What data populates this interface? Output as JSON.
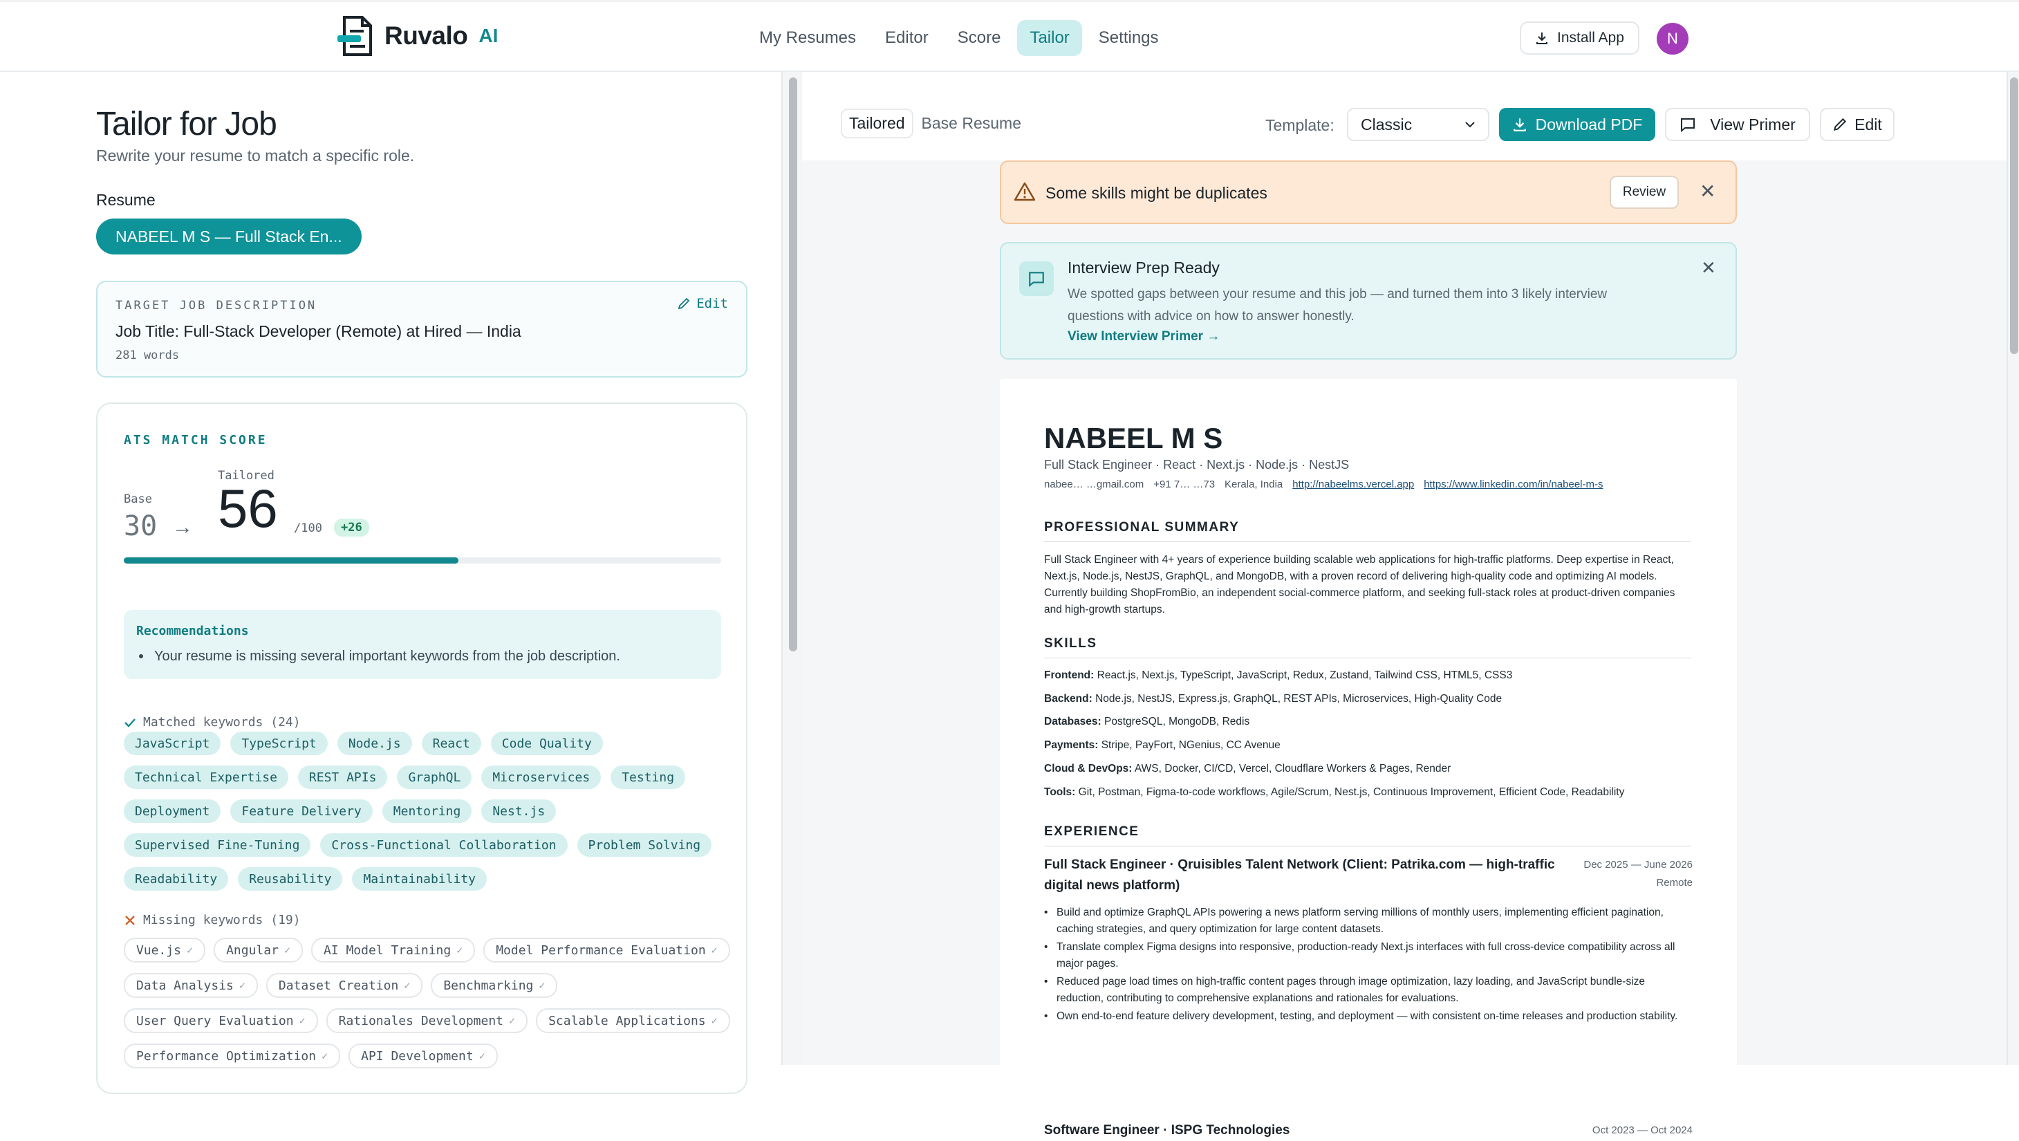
{
  "app": {
    "name": "Ruvalo",
    "suffix": "AI"
  },
  "nav": {
    "items": [
      {
        "label": "My Resumes",
        "active": false
      },
      {
        "label": "Editor",
        "active": false
      },
      {
        "label": "Score",
        "active": false
      },
      {
        "label": "Tailor",
        "active": true
      },
      {
        "label": "Settings",
        "active": false
      }
    ],
    "install_label": "Install App",
    "avatar_initial": "N"
  },
  "left": {
    "title": "Tailor for Job",
    "subtitle": "Rewrite your resume to match a specific role.",
    "resume_label": "Resume",
    "resume_selected": "NABEEL M S — Full Stack En...",
    "jd": {
      "label": "TARGET JOB DESCRIPTION",
      "edit_label": "Edit",
      "title": "Job Title: Full-Stack Developer (Remote) at Hired — India",
      "words": "281 words"
    },
    "ats": {
      "label": "ATS MATCH SCORE",
      "base_label": "Base",
      "base_value": "30",
      "arrow": "→",
      "tailored_label": "Tailored",
      "tailored_value": "56",
      "out_of": "/100",
      "delta": "+26",
      "progress": 0.56,
      "rec_title": "Recommendations",
      "rec_item": "Your resume is missing several important keywords from the job description.",
      "matched_header": "Matched keywords (24)",
      "matched": [
        "JavaScript",
        "TypeScript",
        "Node.js",
        "React",
        "Code Quality",
        "Technical Expertise",
        "REST APIs",
        "GraphQL",
        "Microservices",
        "Testing",
        "Deployment",
        "Feature Delivery",
        "Mentoring",
        "Nest.js",
        "Supervised Fine-Tuning",
        "Cross-Functional Collaboration",
        "Problem Solving",
        "Readability",
        "Reusability",
        "Maintainability"
      ],
      "missing_header": "Missing keywords (19)",
      "missing": [
        "Vue.js",
        "Angular",
        "AI Model Training",
        "Model Performance Evaluation",
        "Data Analysis",
        "Dataset Creation",
        "Benchmarking",
        "User Query Evaluation",
        "Rationales Development",
        "Scalable Applications",
        "Performance Optimization",
        "API Development"
      ]
    }
  },
  "right": {
    "tabs": {
      "tailored": "Tailored",
      "base": "Base Resume"
    },
    "template_label": "Template:",
    "template_value": "Classic",
    "download_label": "Download PDF",
    "primer_label": "View Primer",
    "edit_label": "Edit",
    "warning": {
      "text": "Some skills might be duplicates",
      "review_label": "Review"
    },
    "prep": {
      "title": "Interview Prep Ready",
      "body": "We spotted gaps between your resume and this job — and turned them into 3 likely interview questions with advice on how to answer honestly.",
      "link": "View Interview Primer →"
    },
    "resume": {
      "name": "NABEEL M S",
      "role": "Full Stack Engineer · React · Next.js · Node.js · NestJS",
      "contact": [
        "nabee…    …gmail.com",
        "+91 7…    …73",
        "Kerala, India",
        "http://nabeelms.vercel.app",
        "https://www.linkedin.com/in/nabeel-m-s"
      ],
      "summary_h": "PROFESSIONAL SUMMARY",
      "summary": "Full Stack Engineer with 4+ years of experience building scalable web applications for high-traffic platforms. Deep expertise in React, Next.js, Node.js, NestJS, GraphQL, and MongoDB, with a proven record of delivering high-quality code and optimizing AI models. Currently building ShopFromBio, an independent social-commerce platform, and seeking full-stack roles at product-driven companies and high-growth startups.",
      "skills_h": "SKILLS",
      "skills": [
        {
          "k": "Frontend:",
          "v": "React.js, Next.js, TypeScript, JavaScript, Redux, Zustand, Tailwind CSS, HTML5, CSS3"
        },
        {
          "k": "Backend:",
          "v": "Node.js, NestJS, Express.js, GraphQL, REST APIs, Microservices, High-Quality Code"
        },
        {
          "k": "Databases:",
          "v": "PostgreSQL, MongoDB, Redis"
        },
        {
          "k": "Payments:",
          "v": "Stripe, PayFort, NGenius, CC Avenue"
        },
        {
          "k": "Cloud & DevOps:",
          "v": "AWS, Docker, CI/CD, Vercel, Cloudflare Workers & Pages, Render"
        },
        {
          "k": "Tools:",
          "v": "Git, Postman, Figma-to-code workflows, Agile/Scrum, Nest.js, Continuous Improvement, Efficient Code, Readability"
        }
      ],
      "exp_h": "EXPERIENCE",
      "job1_title": "Full Stack Engineer · Qruisibles Talent Network (Client: Patrika.com — high-traffic digital news platform)",
      "job1_date": "Dec 2025 — June 2026",
      "job1_loc": "Remote",
      "job1_bullets": [
        "Build and optimize GraphQL APIs powering a news platform serving millions of monthly users, implementing efficient pagination, caching strategies, and query optimization for large content datasets.",
        "Translate complex Figma designs into responsive, production-ready Next.js interfaces with full cross-device compatibility across all major pages.",
        "Reduced page load times on high-traffic content pages through image optimization, lazy loading, and JavaScript bundle-size reduction, contributing to comprehensive explanations and rationales for evaluations.",
        "Own end-to-end feature delivery development, testing, and deployment — with consistent on-time releases and production stability."
      ],
      "job2_title": "Software Engineer · ISPG Technologies",
      "job2_date": "Oct 2023 — Oct 2024"
    }
  }
}
